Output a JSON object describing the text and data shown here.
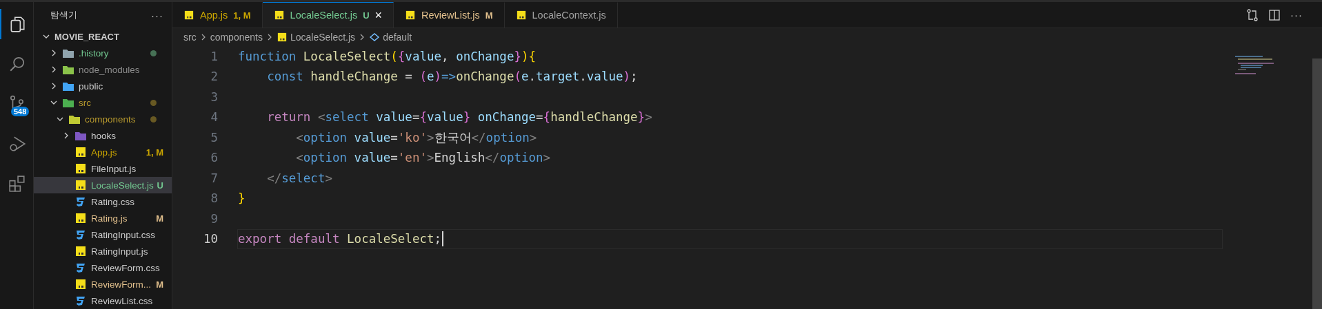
{
  "activity_bar": {
    "items": [
      {
        "kind": "explorer",
        "selected": true
      },
      {
        "kind": "search",
        "selected": false
      },
      {
        "kind": "source-control",
        "selected": false,
        "badge": "548"
      },
      {
        "kind": "run-debug",
        "selected": false
      },
      {
        "kind": "extensions",
        "selected": false
      }
    ]
  },
  "explorer": {
    "title": "탐색기",
    "more": "···",
    "project": {
      "name": "MOVIE_REACT",
      "expanded": true
    },
    "tree": [
      {
        "name": ".history",
        "kind": "folder-gray",
        "color": "#73c991",
        "dot": true,
        "selected": false,
        "expanded": false
      },
      {
        "name": "node_modules",
        "kind": "folder-node",
        "color": "#8c8c8c",
        "dot": false,
        "selected": false,
        "expanded": false
      },
      {
        "name": "public",
        "kind": "folder-public",
        "color": "#cccccc",
        "dot": false,
        "selected": false,
        "expanded": false
      },
      {
        "name": "src",
        "kind": "folder-src",
        "color": "#b89a2e",
        "dot": true,
        "selected": false,
        "expanded": true,
        "children": [
          {
            "name": "components",
            "kind": "folder-components",
            "color": "#b89a2e",
            "dot": true,
            "selected": false,
            "expanded": true,
            "children": [
              {
                "name": "hooks",
                "kind": "folder-hooks",
                "color": "#cccccc",
                "dot": false,
                "selected": false,
                "expanded": false
              },
              {
                "name": "App.js",
                "kind": "js",
                "color": "#cca700",
                "badge": "1, M",
                "dot": false,
                "selected": false
              },
              {
                "name": "FileInput.js",
                "kind": "js",
                "color": "#cccccc",
                "dot": false,
                "selected": false
              },
              {
                "name": "LocaleSelect.js",
                "kind": "js",
                "color": "#73c991",
                "badge": "U",
                "dot": false,
                "selected": true
              },
              {
                "name": "Rating.css",
                "kind": "css",
                "color": "#cccccc",
                "dot": false,
                "selected": false
              },
              {
                "name": "Rating.js",
                "kind": "js",
                "color": "#e2c08d",
                "badge": "M",
                "dot": false,
                "selected": false
              },
              {
                "name": "RatingInput.css",
                "kind": "css",
                "color": "#cccccc",
                "dot": false,
                "selected": false
              },
              {
                "name": "RatingInput.js",
                "kind": "js",
                "color": "#cccccc",
                "dot": false,
                "selected": false
              },
              {
                "name": "ReviewForm.css",
                "kind": "css",
                "color": "#cccccc",
                "dot": false,
                "selected": false
              },
              {
                "name": "ReviewForm...",
                "kind": "js",
                "color": "#e2c08d",
                "badge": "M",
                "dot": false,
                "selected": false
              },
              {
                "name": "ReviewList.css",
                "kind": "css",
                "color": "#cccccc",
                "dot": false,
                "selected": false
              }
            ]
          }
        ]
      }
    ]
  },
  "tabs": [
    {
      "label": "App.js",
      "badge": "1, M",
      "color": "#cca700",
      "selected": false
    },
    {
      "label": "LocaleSelect.js",
      "badge": "U",
      "color": "#73c991",
      "selected": true,
      "close": "×"
    },
    {
      "label": "ReviewList.js",
      "badge": "M",
      "color": "#e2c08d",
      "selected": false
    },
    {
      "label": "LocaleContext.js",
      "color": "#a0a0a0",
      "selected": false
    }
  ],
  "breadcrumb": [
    {
      "kind": "folder",
      "text": "src"
    },
    {
      "kind": "folder",
      "text": "components"
    },
    {
      "kind": "file",
      "text": "LocaleSelect.js"
    },
    {
      "kind": "symbol",
      "text": "default"
    }
  ],
  "code": {
    "lines": [
      {
        "number": "1",
        "selected": false,
        "tokens": [
          {
            "text": "function ",
            "kind": "keyword"
          },
          {
            "text": "LocaleSelect",
            "kind": "func"
          },
          {
            "text": "(",
            "kind": "b1"
          },
          {
            "text": "{",
            "kind": "b2"
          },
          {
            "text": "value",
            "kind": "param"
          },
          {
            "text": ", ",
            "kind": "text"
          },
          {
            "text": "onChange",
            "kind": "param"
          },
          {
            "text": "}",
            "kind": "b2"
          },
          {
            "text": ")",
            "kind": "b1"
          },
          {
            "text": "{",
            "kind": "b1"
          }
        ]
      },
      {
        "number": "2",
        "selected": false,
        "tokens": [
          {
            "text": "    const ",
            "kind": "keyword"
          },
          {
            "text": "handleChange",
            "kind": "func"
          },
          {
            "text": " = ",
            "kind": "text"
          },
          {
            "text": "(",
            "kind": "b2"
          },
          {
            "text": "e",
            "kind": "param"
          },
          {
            "text": ")",
            "kind": "b2"
          },
          {
            "text": "=>",
            "kind": "keyword"
          },
          {
            "text": "onChange",
            "kind": "func"
          },
          {
            "text": "(",
            "kind": "b2"
          },
          {
            "text": "e",
            "kind": "param"
          },
          {
            "text": ".",
            "kind": "text"
          },
          {
            "text": "target",
            "kind": "param"
          },
          {
            "text": ".",
            "kind": "text"
          },
          {
            "text": "value",
            "kind": "param"
          },
          {
            "text": ")",
            "kind": "b2"
          },
          {
            "text": ";",
            "kind": "text"
          }
        ]
      },
      {
        "number": "3",
        "selected": false
      },
      {
        "number": "4",
        "selected": false,
        "tokens": [
          {
            "text": "    return ",
            "kind": "control"
          },
          {
            "text": "<",
            "kind": "punct"
          },
          {
            "text": "select ",
            "kind": "tag"
          },
          {
            "text": "value",
            "kind": "param"
          },
          {
            "text": "=",
            "kind": "text"
          },
          {
            "text": "{",
            "kind": "b2"
          },
          {
            "text": "value",
            "kind": "param"
          },
          {
            "text": "} ",
            "kind": "b2"
          },
          {
            "text": "onChange",
            "kind": "param"
          },
          {
            "text": "=",
            "kind": "text"
          },
          {
            "text": "{",
            "kind": "b2"
          },
          {
            "text": "handleChange",
            "kind": "func"
          },
          {
            "text": "}",
            "kind": "b2"
          },
          {
            "text": ">",
            "kind": "punct"
          }
        ]
      },
      {
        "number": "5",
        "selected": false,
        "tokens": [
          {
            "text": "        <",
            "kind": "punct"
          },
          {
            "text": "option ",
            "kind": "tag"
          },
          {
            "text": "value",
            "kind": "param"
          },
          {
            "text": "=",
            "kind": "text"
          },
          {
            "text": "'ko'",
            "kind": "string"
          },
          {
            "text": ">",
            "kind": "punct"
          },
          {
            "text": "한국어",
            "kind": "text"
          },
          {
            "text": "</",
            "kind": "punct"
          },
          {
            "text": "option",
            "kind": "tag"
          },
          {
            "text": ">",
            "kind": "punct"
          }
        ]
      },
      {
        "number": "6",
        "selected": false,
        "tokens": [
          {
            "text": "        <",
            "kind": "punct"
          },
          {
            "text": "option ",
            "kind": "tag"
          },
          {
            "text": "value",
            "kind": "param"
          },
          {
            "text": "=",
            "kind": "text"
          },
          {
            "text": "'en'",
            "kind": "string"
          },
          {
            "text": ">",
            "kind": "punct"
          },
          {
            "text": "English",
            "kind": "text"
          },
          {
            "text": "</",
            "kind": "punct"
          },
          {
            "text": "option",
            "kind": "tag"
          },
          {
            "text": ">",
            "kind": "punct"
          }
        ]
      },
      {
        "number": "7",
        "selected": false,
        "tokens": [
          {
            "text": "    </",
            "kind": "punct"
          },
          {
            "text": "select",
            "kind": "tag"
          },
          {
            "text": ">",
            "kind": "punct"
          }
        ]
      },
      {
        "number": "8",
        "selected": false,
        "tokens": [
          {
            "text": "}",
            "kind": "b1"
          }
        ]
      },
      {
        "number": "9",
        "selected": false
      },
      {
        "number": "10",
        "selected": true,
        "tokens": [
          {
            "text": "export ",
            "kind": "control"
          },
          {
            "text": "default ",
            "kind": "control"
          },
          {
            "text": "LocaleSelect",
            "kind": "func"
          },
          {
            "text": ";",
            "kind": "text"
          }
        ]
      }
    ]
  },
  "editor_actions": [
    {
      "kind": "compare"
    },
    {
      "kind": "split"
    },
    {
      "kind": "more",
      "text": "···"
    }
  ]
}
